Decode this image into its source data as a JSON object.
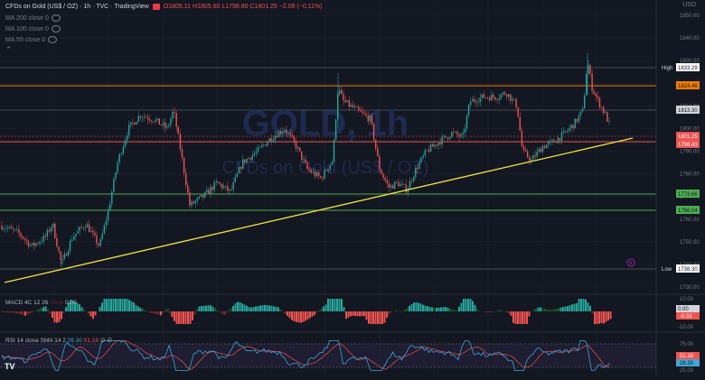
{
  "header": {
    "title": "CFDs on Gold (US$ / OZ) · 1h · TVC · TradingView",
    "ohlc": "O1805.11 H1805.60 L1798.80 C1801.25 −2.06 (−0.11%)",
    "indicators": [
      "MA 200 close 0",
      "MA 100 close 0",
      "MA 55 close 0"
    ]
  },
  "watermark": {
    "symbol": "GOLD, 1h",
    "description": "CFDs on Gold (US$ / OZ)"
  },
  "top_right_label": "USD",
  "price_axis": {
    "ticks": [
      "1850.00",
      "1840.00",
      "1830.00",
      "1820.00",
      "1810.00",
      "1800.00",
      "1790.00",
      "1780.00",
      "1770.00",
      "1760.00",
      "1750.00",
      "1740.00",
      "1730.00"
    ],
    "labels": {
      "high_tag": "High",
      "high_value": "1833.29",
      "low_tag": "Low",
      "low_value": "1738.30",
      "resistance_1": "1824.46",
      "resistance_2": "1813.30",
      "current_price": "1801.25",
      "current_countdown": "1798.43",
      "support_1": "1773.66",
      "support_2": "1766.04"
    }
  },
  "macd": {
    "legend_name": "MACD 4C",
    "legend_params": "12 26",
    "legend_hidden": "close",
    "legend_value": "0.00",
    "axis_labels": [
      "0.00",
      "-0.32"
    ],
    "axis_ticks": [
      "10.00",
      "-10.00"
    ]
  },
  "rsi": {
    "legend_name": "RSI",
    "legend_params": "14 close SMA 14 2",
    "legend_values": "26.30",
    "legend_values_2": "51.18",
    "legend_values_3": "∅ ∅",
    "axis_ticks": [
      "75.00",
      "50.00",
      "25.00"
    ],
    "axis_labels": [
      "51.18",
      "26.30"
    ]
  },
  "colors": {
    "background": "#131722",
    "up_candle": "#26a69a",
    "down_candle": "#ef5350",
    "trendline": "#f0e442",
    "support_line": "#4caf50",
    "resistance_line": "#f57c00",
    "rsi_line": "#3fa7d6",
    "rsi_ma": "#ef5350"
  }
}
